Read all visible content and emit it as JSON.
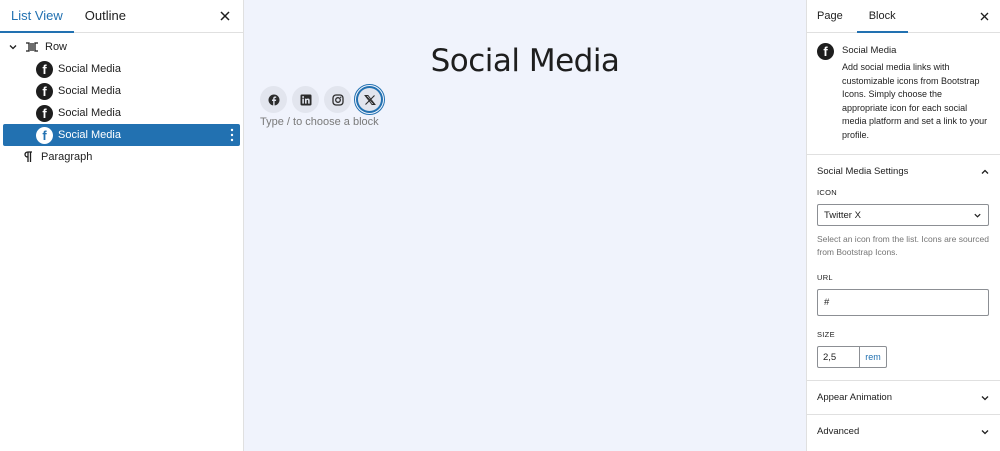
{
  "left_panel": {
    "tabs": [
      {
        "label": "List View",
        "active": true
      },
      {
        "label": "Outline",
        "active": false
      }
    ],
    "tree": [
      {
        "label": "Row",
        "depth": 0,
        "icon": "row-icon",
        "expandable": true
      },
      {
        "label": "Social Media",
        "depth": 1,
        "icon": "facebook-icon",
        "selected": false
      },
      {
        "label": "Social Media",
        "depth": 1,
        "icon": "facebook-icon",
        "selected": false
      },
      {
        "label": "Social Media",
        "depth": 1,
        "icon": "facebook-icon",
        "selected": false
      },
      {
        "label": "Social Media",
        "depth": 1,
        "icon": "facebook-icon",
        "selected": true
      },
      {
        "label": "Paragraph",
        "depth": 0,
        "icon": "paragraph-icon"
      }
    ]
  },
  "canvas": {
    "heading": "Social Media",
    "social_icons": [
      {
        "name": "facebook-icon",
        "selected": false
      },
      {
        "name": "linkedin-icon",
        "selected": false
      },
      {
        "name": "instagram-icon",
        "selected": false
      },
      {
        "name": "twitter-x-icon",
        "selected": true
      }
    ],
    "placeholder": "Type / to choose a block"
  },
  "right_panel": {
    "tabs": [
      {
        "label": "Page",
        "active": false
      },
      {
        "label": "Block",
        "active": true
      }
    ],
    "block": {
      "title": "Social Media",
      "description": "Add social media links with customizable icons from Bootstrap Icons. Simply choose the appropriate icon for each social media platform and set a link to your profile."
    },
    "settings": {
      "title": "Social Media Settings",
      "icon_label": "ICON",
      "icon_value": "Twitter X",
      "icon_help": "Select an icon from the list. Icons are sourced from Bootstrap Icons.",
      "url_label": "URL",
      "url_value": "#",
      "size_label": "SIZE",
      "size_value": "2,5",
      "size_unit": "rem"
    },
    "appear_animation": "Appear Animation",
    "advanced": "Advanced"
  },
  "colors": {
    "accent": "#2271b1",
    "canvas_bg": "#f0f3fc",
    "icon_bg": "#e2e5ee"
  }
}
